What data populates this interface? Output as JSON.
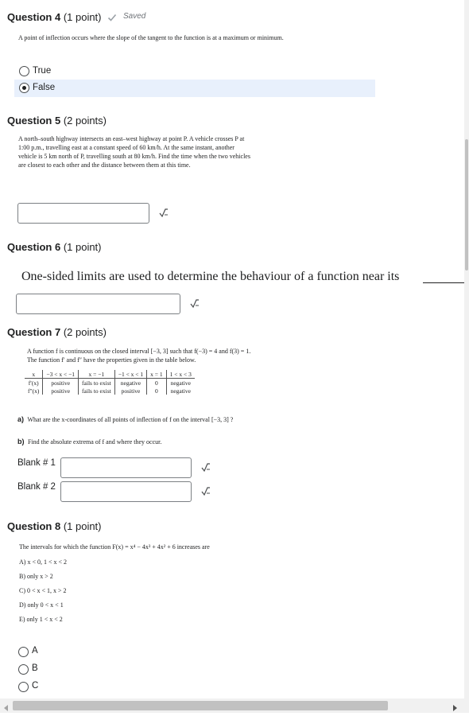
{
  "q4": {
    "title": "Question 4",
    "points": "(1 point)",
    "saved": "Saved",
    "text": "A point of inflection occurs where the slope of the tangent to the function is at a maximum or minimum.",
    "options": [
      "True",
      "False"
    ],
    "selected": "False"
  },
  "q5": {
    "title": "Question 5",
    "points": "(2 points)",
    "text": "A north–south highway intersects an east–west highway at point P. A vehicle crosses P at 1:00 p.m., travelling east at a constant speed of 60 km/h. At the same instant, another vehicle is 5 km north of P, travelling south at 80 km/h. Find the time when the two vehicles are closest to each other and the distance between them at this time.",
    "answer": ""
  },
  "q6": {
    "title": "Question 6",
    "points": "(1 point)",
    "text": "One-sided limits are used to determine the behaviour of a function near its",
    "answer": ""
  },
  "q7": {
    "title": "Question 7",
    "points": "(2 points)",
    "text1": "A function f is continuous on the closed interval [−3, 3] such that f(−3) = 4 and f(3) = 1.",
    "text2": "The function f′ and f″ have the properties given in the table below.",
    "table": {
      "header": [
        "x",
        "−3 < x < −1",
        "x = −1",
        "−1 < x < 1",
        "x = 1",
        "1 < x < 3"
      ],
      "rows": [
        [
          "f′(x)",
          "positive",
          "fails to exist",
          "negative",
          "0",
          "negative"
        ],
        [
          "f″(x)",
          "positive",
          "fails to exist",
          "positive",
          "0",
          "negative"
        ]
      ]
    },
    "part_a_label": "a)",
    "part_a": "What are the x-coordinates of all points of inflection of f on the interval [−3, 3] ?",
    "part_b_label": "b)",
    "part_b": "Find the absolute extrema of f and where they occur.",
    "blank1_label": "Blank # 1",
    "blank2_label": "Blank # 2",
    "blank1": "",
    "blank2": ""
  },
  "q8": {
    "title": "Question 8",
    "points": "(1 point)",
    "text": "The intervals for which the function F(x) = x⁴ − 4x³ + 4x² + 6 increases are",
    "choices": [
      "A) x < 0, 1 < x < 2",
      "B) only x > 2",
      "C) 0 < x < 1, x > 2",
      "D) only 0 < x < 1",
      "E) only 1 < x < 2"
    ],
    "options": [
      "A",
      "B",
      "C"
    ]
  },
  "icons": {
    "check": "check-icon",
    "equation": "equation-editor-icon",
    "scroll_left": "arrow-left-icon",
    "scroll_right": "arrow-right-icon"
  }
}
